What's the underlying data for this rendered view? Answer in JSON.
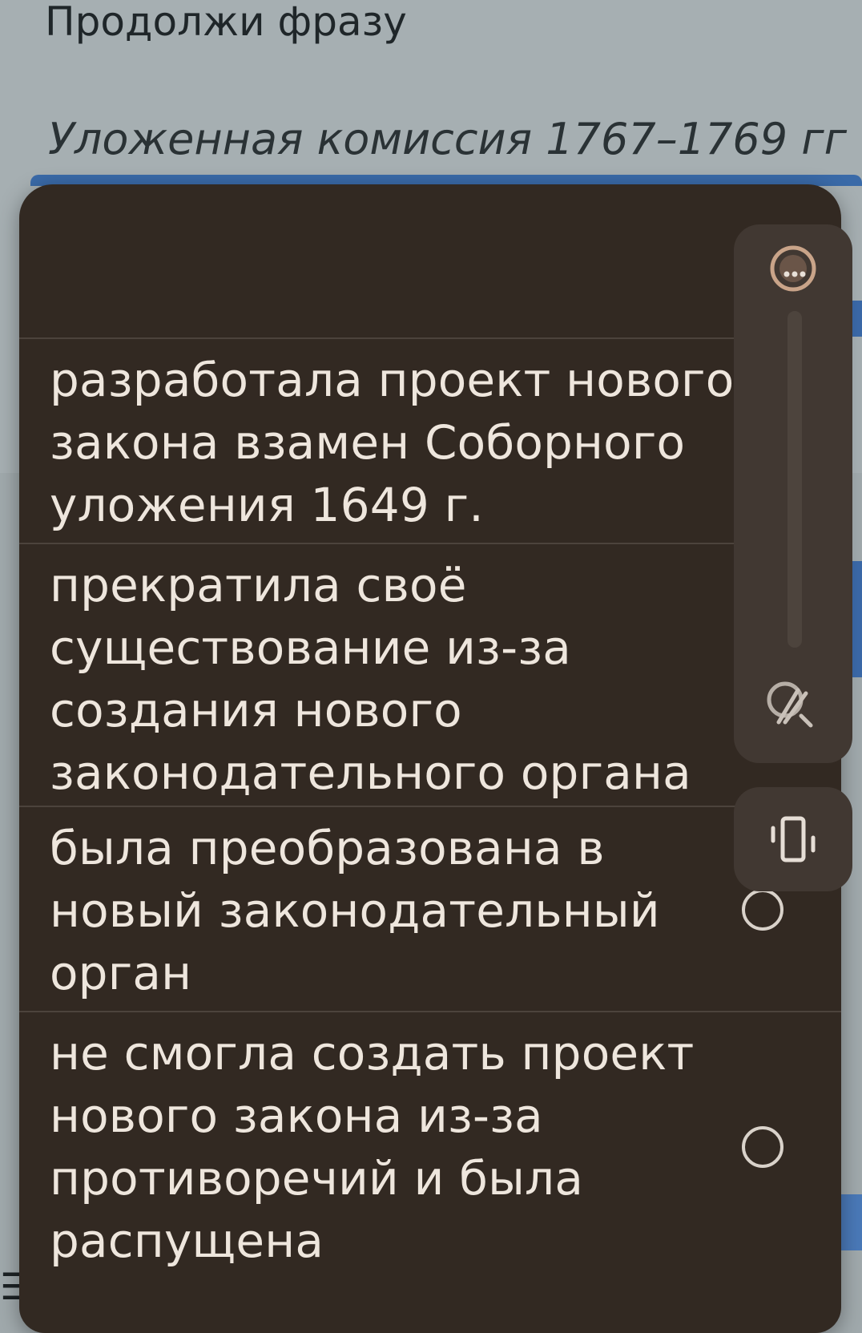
{
  "question": {
    "heading": "Продолжи фразу",
    "subject": "Уложенная комиссия 1767–1769 гг"
  },
  "options": [
    {
      "text": "разработала проект нового закона взамен Соборного уложения 1649 г.",
      "selected": false
    },
    {
      "text": "прекратила своё существование из-за создания нового законодательного органа",
      "selected": false
    },
    {
      "text": "была преобразована в новый законодательный орган",
      "selected": false
    },
    {
      "text": "не смогла создать проект нового закона из-за противоречий и была распущена",
      "selected": false
    }
  ],
  "volume_panel": {
    "top_icon": "sound-mode-icon",
    "bottom_icon": "live-caption-off-icon",
    "level": 0
  },
  "vibrate_panel": {
    "icon": "vibrate-icon"
  },
  "menu_icon": "menu-icon",
  "colors": {
    "popup_background": "#322922",
    "popup_text": "#eee6dd",
    "accent_blue": "#3a6aa8",
    "backdrop": "#a4adb0"
  }
}
